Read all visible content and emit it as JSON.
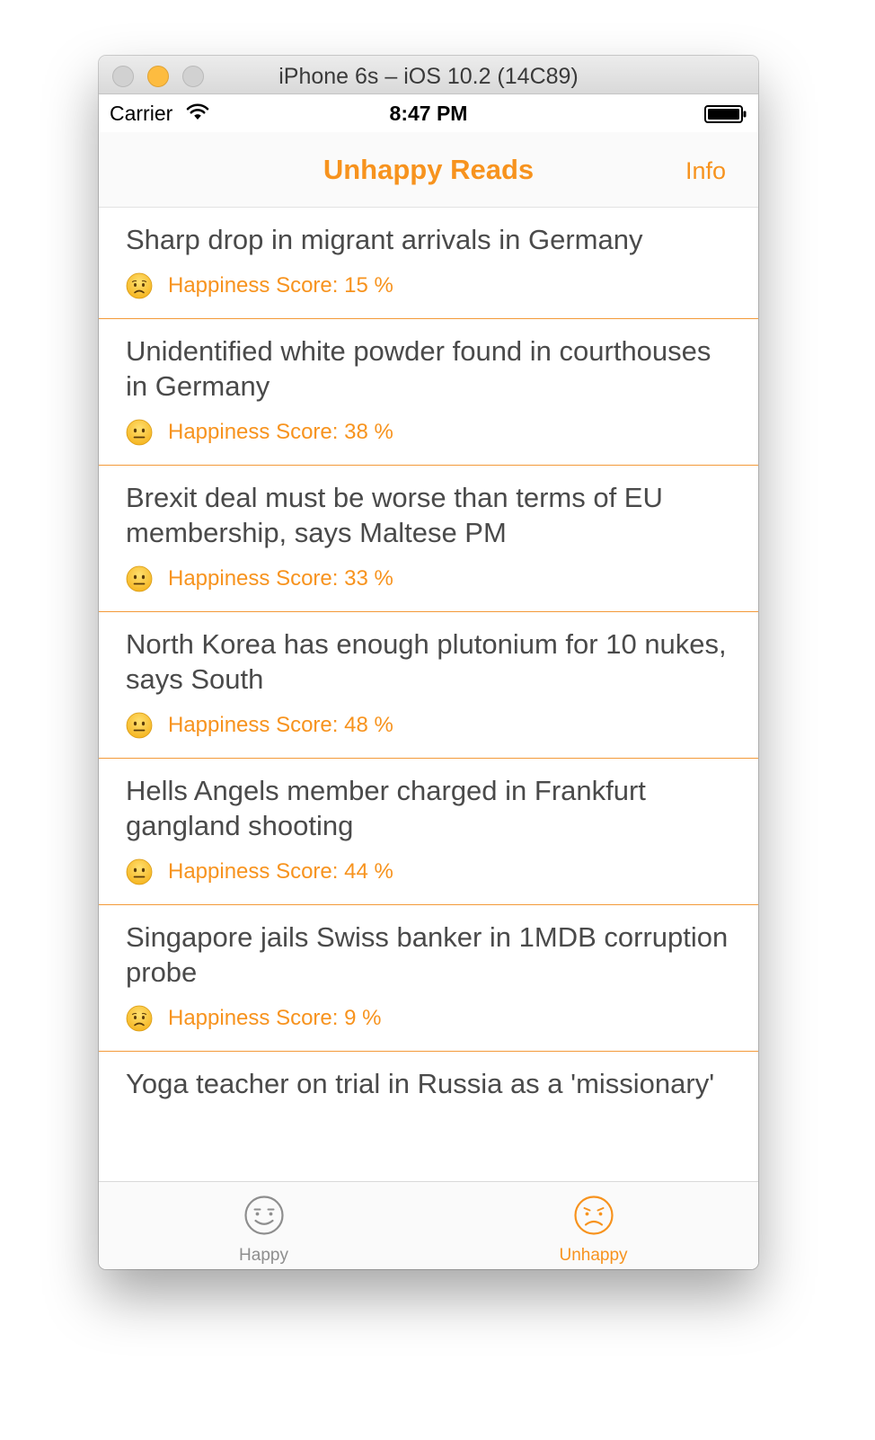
{
  "window": {
    "title": "iPhone 6s – iOS 10.2 (14C89)"
  },
  "status_bar": {
    "carrier": "Carrier",
    "time": "8:47 PM",
    "wifi_icon": "wifi-icon",
    "battery_icon": "battery-full-icon"
  },
  "nav": {
    "title": "Unhappy Reads",
    "info_button": "Info"
  },
  "colors": {
    "accent": "#f7931e",
    "headline_text": "#4a4a4a",
    "separator": "#f39a3a",
    "inactive_tab": "#8e8e8e"
  },
  "articles": [
    {
      "headline": "Sharp drop in migrant arrivals in Germany",
      "score_text": "Happiness Score: 15 %",
      "score": 15,
      "face_icon": "sad-face-icon"
    },
    {
      "headline": "Unidentified white powder found in courthouses in Germany",
      "score_text": "Happiness Score: 38 %",
      "score": 38,
      "face_icon": "neutral-face-icon"
    },
    {
      "headline": "Brexit deal must be worse than terms of EU membership, says Maltese PM",
      "score_text": "Happiness Score: 33 %",
      "score": 33,
      "face_icon": "neutral-face-icon"
    },
    {
      "headline": "North Korea has enough plutonium for 10 nukes, says South",
      "score_text": "Happiness Score: 48 %",
      "score": 48,
      "face_icon": "neutral-face-icon"
    },
    {
      "headline": "Hells Angels member charged in Frankfurt gangland shooting",
      "score_text": "Happiness Score: 44 %",
      "score": 44,
      "face_icon": "neutral-face-icon"
    },
    {
      "headline": "Singapore jails Swiss banker in 1MDB corruption probe",
      "score_text": "Happiness Score: 9 %",
      "score": 9,
      "face_icon": "sad-face-icon"
    },
    {
      "headline": "Yoga teacher on trial in Russia as a 'missionary'",
      "score_text": "",
      "score": null,
      "face_icon": ""
    }
  ],
  "tabs": [
    {
      "label": "Happy",
      "icon": "smiley-face-icon",
      "selected": false
    },
    {
      "label": "Unhappy",
      "icon": "frown-face-icon",
      "selected": true
    }
  ]
}
